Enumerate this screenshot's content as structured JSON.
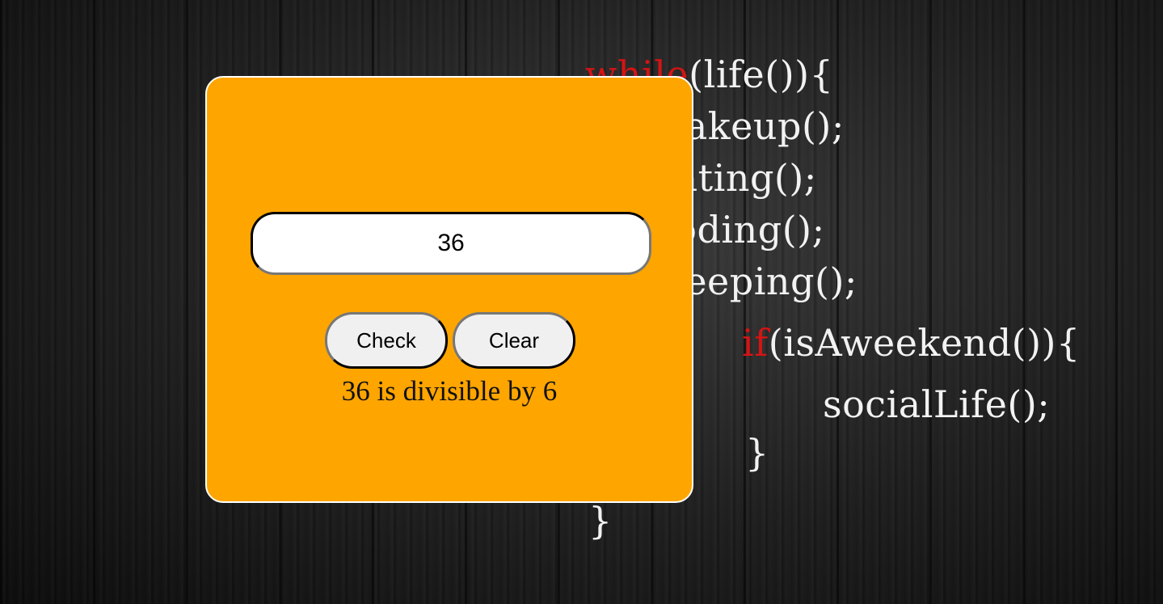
{
  "background": {
    "code_lines": [
      {
        "kw": "while",
        "rest": "(life()){"
      },
      {
        "kw": "",
        "rest": "wakeup();"
      },
      {
        "kw": "",
        "rest": "eating();"
      },
      {
        "kw": "",
        "rest": "coding();"
      },
      {
        "kw": "",
        "rest": "sleeping();"
      },
      {
        "kw": "if",
        "rest": "(isAweekend()){"
      },
      {
        "kw": "",
        "rest": "socialLife();"
      },
      {
        "kw": "",
        "rest": "}"
      },
      {
        "kw": "",
        "rest": "}"
      }
    ]
  },
  "form": {
    "input_value": "36",
    "check_label": "Check",
    "clear_label": "Clear",
    "result_text": "36 is divisible by 6"
  },
  "colors": {
    "card": "#ffa500",
    "keyword": "#d41414"
  }
}
